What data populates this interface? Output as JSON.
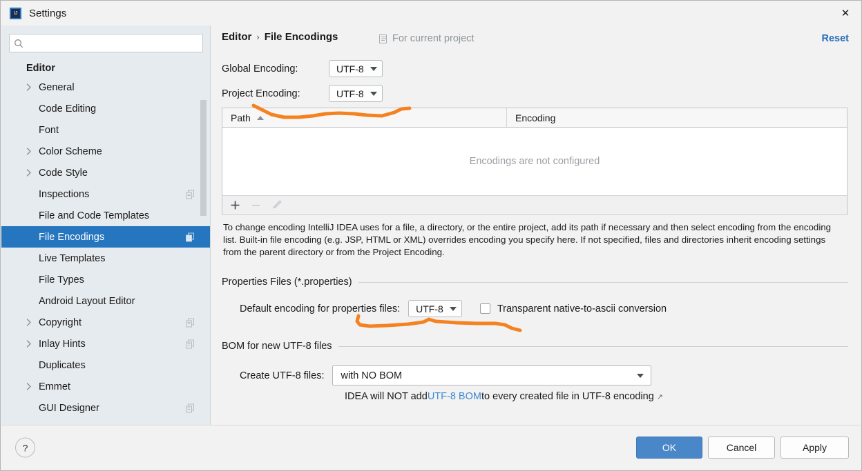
{
  "window": {
    "title": "Settings",
    "app_icon": "intellij-idea-icon",
    "close_icon": "close-icon"
  },
  "sidebar": {
    "search": {
      "value": "",
      "placeholder": "",
      "icon": "search-icon"
    },
    "root_label": "Editor",
    "items": [
      {
        "label": "General",
        "expandable": true,
        "selected": false,
        "badge": false
      },
      {
        "label": "Code Editing",
        "expandable": false,
        "selected": false,
        "badge": false
      },
      {
        "label": "Font",
        "expandable": false,
        "selected": false,
        "badge": false
      },
      {
        "label": "Color Scheme",
        "expandable": true,
        "selected": false,
        "badge": false
      },
      {
        "label": "Code Style",
        "expandable": true,
        "selected": false,
        "badge": false
      },
      {
        "label": "Inspections",
        "expandable": false,
        "selected": false,
        "badge": true
      },
      {
        "label": "File and Code Templates",
        "expandable": false,
        "selected": false,
        "badge": false
      },
      {
        "label": "File Encodings",
        "expandable": false,
        "selected": true,
        "badge": true
      },
      {
        "label": "Live Templates",
        "expandable": false,
        "selected": false,
        "badge": false
      },
      {
        "label": "File Types",
        "expandable": false,
        "selected": false,
        "badge": false
      },
      {
        "label": "Android Layout Editor",
        "expandable": false,
        "selected": false,
        "badge": false
      },
      {
        "label": "Copyright",
        "expandable": true,
        "selected": false,
        "badge": true
      },
      {
        "label": "Inlay Hints",
        "expandable": true,
        "selected": false,
        "badge": true
      },
      {
        "label": "Duplicates",
        "expandable": false,
        "selected": false,
        "badge": false
      },
      {
        "label": "Emmet",
        "expandable": true,
        "selected": false,
        "badge": false
      },
      {
        "label": "GUI Designer",
        "expandable": false,
        "selected": false,
        "badge": true
      }
    ]
  },
  "header": {
    "breadcrumb_parent": "Editor",
    "breadcrumb_separator": "›",
    "breadcrumb_current": "File Encodings",
    "project_scope_label": "For current project",
    "project_scope_icon": "project-scope-icon",
    "reset_label": "Reset"
  },
  "main": {
    "global_encoding_label": "Global Encoding:",
    "global_encoding_value": "UTF-8",
    "project_encoding_label": "Project Encoding:",
    "project_encoding_value": "UTF-8",
    "table": {
      "columns": [
        "Path",
        "Encoding"
      ],
      "sort_column": "Path",
      "sort_direction": "ascending",
      "empty_message": "Encodings are not configured",
      "rows": [],
      "toolbar": [
        {
          "name": "add-button",
          "icon": "plus-icon",
          "enabled": true
        },
        {
          "name": "remove-button",
          "icon": "minus-icon",
          "enabled": false
        },
        {
          "name": "edit-button",
          "icon": "pencil-icon",
          "enabled": false
        }
      ]
    },
    "description": "To change encoding IntelliJ IDEA uses for a file, a directory, or the entire project, add its path if necessary and then select encoding from the encoding list. Built-in file encoding (e.g. JSP, HTML or XML) overrides encoding you specify here. If not specified, files and directories inherit encoding settings from the parent directory or from the Project Encoding.",
    "properties_group": {
      "title": "Properties Files (*.properties)",
      "default_encoding_label": "Default encoding for properties files:",
      "default_encoding_value": "UTF-8",
      "transparent_checkbox_label": "Transparent native-to-ascii conversion",
      "transparent_checkbox_checked": false
    },
    "bom_group": {
      "title": "BOM for new UTF-8 files",
      "create_label": "Create UTF-8 files:",
      "create_value": "with NO BOM",
      "hint_prefix": "IDEA will NOT add ",
      "hint_link": "UTF-8 BOM",
      "hint_suffix": " to every created file in UTF-8 encoding",
      "hint_external_icon": "↗"
    }
  },
  "footer": {
    "help_label": "?",
    "ok_label": "OK",
    "cancel_label": "Cancel",
    "apply_label": "Apply"
  },
  "annotations": {
    "ink_color": "#F58220",
    "marks": [
      {
        "name": "underline-project-encoding",
        "note": "hand-drawn orange underline beneath Project Encoding dropdown"
      },
      {
        "name": "underline-properties-encoding",
        "note": "hand-drawn orange underline beneath Default encoding for properties files"
      }
    ]
  },
  "colors": {
    "selection_blue": "#2675bf",
    "link_blue": "#2a6fb8",
    "primary_button": "#4a87c8",
    "sidebar_bg": "#e6ebef",
    "content_bg": "#f2f2f2",
    "annotation_orange": "#F58220"
  }
}
